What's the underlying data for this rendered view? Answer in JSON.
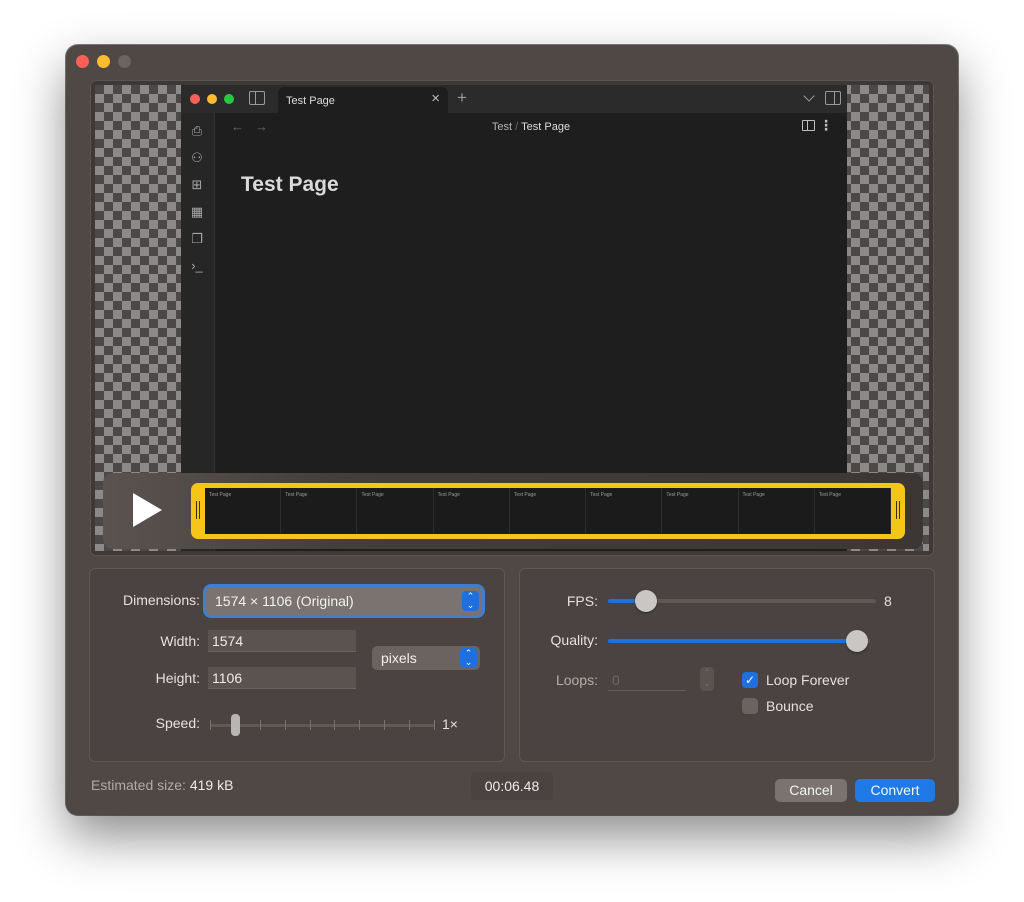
{
  "window": {
    "traffic_lights": [
      "close",
      "minimize",
      "zoom-disabled"
    ]
  },
  "preview": {
    "app": {
      "tab_title": "Test Page",
      "tab_close": "×",
      "new_tab": "+",
      "breadcrumb": {
        "parent": "Test",
        "separator": "/",
        "current": "Test Page"
      },
      "note_title": "Test Page",
      "ribbon_icons": [
        "quick-switcher-icon",
        "graph-view-icon",
        "canvas-icon",
        "daily-note-icon",
        "templates-icon",
        "command-palette-icon"
      ],
      "ribbon_glyphs": [
        "⎙",
        "⚇",
        "⊞",
        "▦",
        "❐",
        "›_"
      ],
      "nav_back": "←",
      "nav_forward": "→",
      "more": "⋮",
      "ocr_glyph": "☰"
    },
    "timeline": {
      "frame_count": 9,
      "frame_label": "Test Page"
    }
  },
  "settings": {
    "dimensions": {
      "label": "Dimensions:",
      "value": "1574 × 1106 (Original)"
    },
    "width": {
      "label": "Width:",
      "value": "1574"
    },
    "height": {
      "label": "Height:",
      "value": "1106"
    },
    "unit": {
      "value": "pixels"
    },
    "speed": {
      "label": "Speed:",
      "value_label": "1×",
      "tick_count": 10,
      "selected_index": 1
    },
    "fps": {
      "label": "FPS:",
      "value": "8",
      "fraction": 0.14
    },
    "quality": {
      "label": "Quality:",
      "fraction": 0.95
    },
    "loops": {
      "label": "Loops:",
      "value": "0"
    },
    "loop_forever": {
      "label": "Loop Forever",
      "checked": true
    },
    "bounce": {
      "label": "Bounce",
      "checked": false
    }
  },
  "footer": {
    "estimated_label": "Estimated size:",
    "estimated_value": "419 kB",
    "time": "00:06.48",
    "cancel": "Cancel",
    "convert": "Convert"
  },
  "colors": {
    "accent": "#1f6fe0",
    "trim": "#f5c518",
    "window_bg": "#4f4845"
  }
}
